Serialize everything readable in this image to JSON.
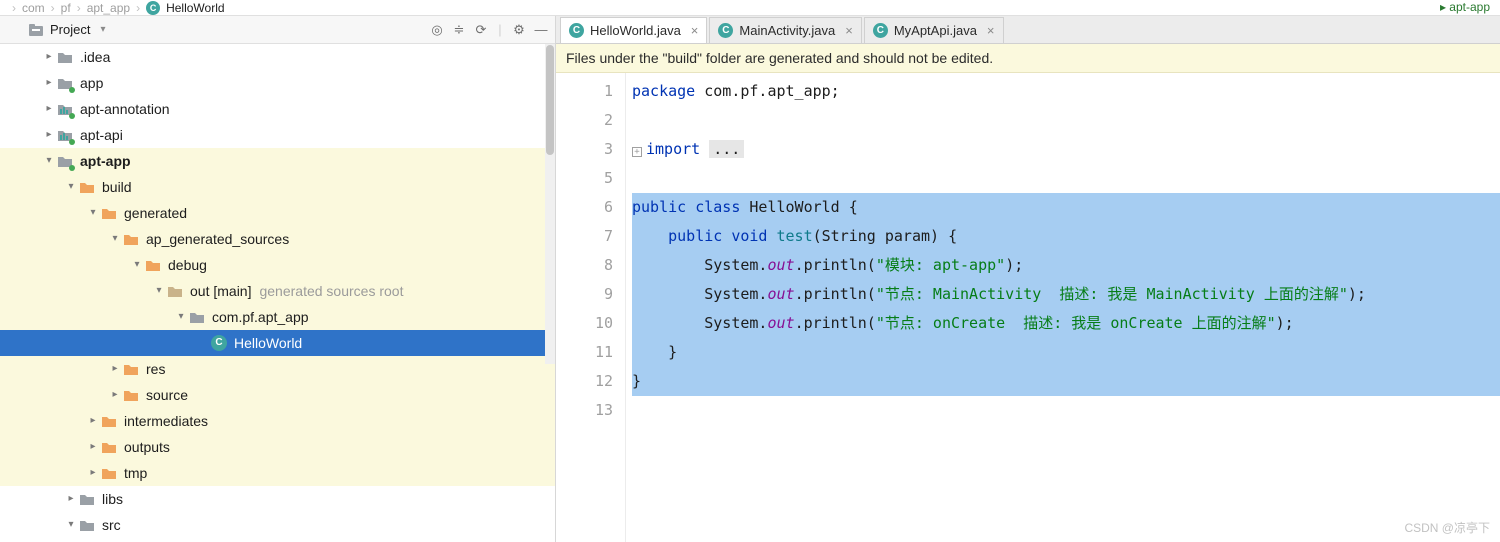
{
  "breadcrumb": [
    "com",
    "pf",
    "apt_app",
    "HelloWorld"
  ],
  "topright": [
    "apt-app",
    ""
  ],
  "project_panel": {
    "title": "Project",
    "tools": [
      "target-icon",
      "flatten-icon",
      "sync-icon",
      "more-icon",
      "settings-icon",
      "minimize-icon"
    ]
  },
  "tree": [
    {
      "depth": 0,
      "arrow": "right",
      "icon": "folder-grey",
      "label": ".idea"
    },
    {
      "depth": 0,
      "arrow": "right",
      "icon": "folder-grey-dot",
      "label": "app"
    },
    {
      "depth": 0,
      "arrow": "right",
      "icon": "folder-bars-dot",
      "label": "apt-annotation"
    },
    {
      "depth": 0,
      "arrow": "right",
      "icon": "folder-bars-dot",
      "label": "apt-api"
    },
    {
      "depth": 0,
      "arrow": "down",
      "icon": "folder-grey-dot",
      "label": "apt-app",
      "bold": true,
      "highlight": true
    },
    {
      "depth": 1,
      "arrow": "down",
      "icon": "folder-orange",
      "label": "build",
      "highlight": true
    },
    {
      "depth": 2,
      "arrow": "down",
      "icon": "folder-orange",
      "label": "generated",
      "highlight": true
    },
    {
      "depth": 3,
      "arrow": "down",
      "icon": "folder-orange",
      "label": "ap_generated_sources",
      "highlight": true
    },
    {
      "depth": 4,
      "arrow": "down",
      "icon": "folder-orange",
      "label": "debug",
      "highlight": true
    },
    {
      "depth": 5,
      "arrow": "down",
      "icon": "folder-tan",
      "label": "out [main]",
      "hint": "generated sources root",
      "highlight": true
    },
    {
      "depth": 6,
      "arrow": "down",
      "icon": "folder-grey",
      "label": "com.pf.apt_app",
      "highlight": true
    },
    {
      "depth": 7,
      "arrow": "",
      "icon": "class",
      "label": "HelloWorld",
      "selected": true
    },
    {
      "depth": 3,
      "arrow": "right",
      "icon": "folder-orange",
      "label": "res",
      "highlight": true
    },
    {
      "depth": 3,
      "arrow": "right",
      "icon": "folder-orange",
      "label": "source",
      "highlight": true
    },
    {
      "depth": 2,
      "arrow": "right",
      "icon": "folder-orange",
      "label": "intermediates",
      "highlight": true
    },
    {
      "depth": 2,
      "arrow": "right",
      "icon": "folder-orange",
      "label": "outputs",
      "highlight": true
    },
    {
      "depth": 2,
      "arrow": "right",
      "icon": "folder-orange",
      "label": "tmp",
      "highlight": true
    },
    {
      "depth": 1,
      "arrow": "right",
      "icon": "folder-grey",
      "label": "libs"
    },
    {
      "depth": 1,
      "arrow": "down",
      "icon": "folder-grey",
      "label": "src"
    }
  ],
  "tabs": [
    {
      "label": "HelloWorld.java",
      "active": true
    },
    {
      "label": "MainActivity.java",
      "active": false
    },
    {
      "label": "MyAptApi.java",
      "active": false
    }
  ],
  "banner": "Files under the \"build\" folder are generated and should not be edited.",
  "line_numbers": [
    "1",
    "2",
    "3",
    "5",
    "6",
    "7",
    "8",
    "9",
    "10",
    "11",
    "12",
    "13"
  ],
  "code": {
    "l1": {
      "kw": "package",
      "rest": " com.pf.apt_app;"
    },
    "l3": {
      "kw": "import",
      "fold": "..."
    },
    "l6": {
      "k1": "public",
      "k2": "class",
      "name": "HelloWorld",
      "brace": " {"
    },
    "l7": {
      "k1": "public",
      "k2": "void",
      "name": "test",
      "params": "(String param) {"
    },
    "l8": {
      "sys": "System.",
      "out": "out",
      "m": ".println(",
      "s": "\"模块: apt-app\"",
      "end": ");"
    },
    "l9": {
      "sys": "System.",
      "out": "out",
      "m": ".println(",
      "s": "\"节点: MainActivity  描述: 我是 MainActivity 上面的注解\"",
      "end": ");"
    },
    "l10": {
      "sys": "System.",
      "out": "out",
      "m": ".println(",
      "s": "\"节点: onCreate  描述: 我是 onCreate 上面的注解\"",
      "end": ");"
    },
    "l11": "    }",
    "l12": "}"
  },
  "watermark": "CSDN @凉亭下"
}
